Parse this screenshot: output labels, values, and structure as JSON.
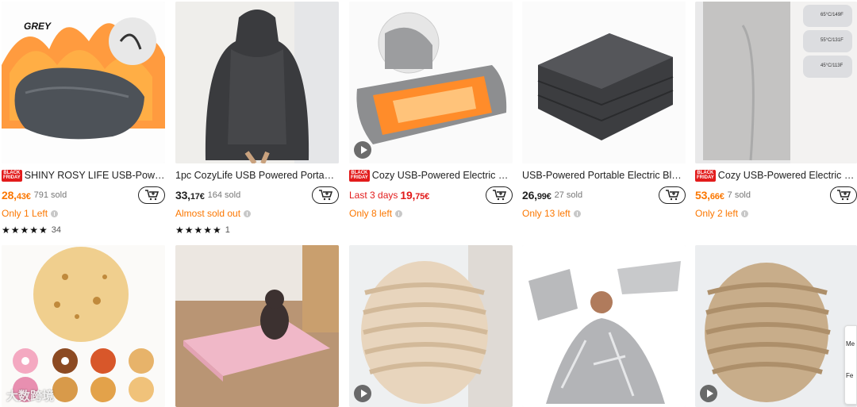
{
  "badge": {
    "line1": "BLACK",
    "line2": "FRIDAY"
  },
  "products": [
    {
      "title": "SHINY ROSY LIFE USB-Powere...",
      "black_friday": true,
      "price_main": "28,",
      "price_cents": "43€",
      "price_color": "orange",
      "sold": "791 sold",
      "stock": "Only 1 Left",
      "stars": "★★★★★",
      "reviews": "34",
      "image_text": "GREY",
      "video": false
    },
    {
      "title": "1pc CozyLife USB Powered Portable F...",
      "black_friday": false,
      "price_main": "33,",
      "price_cents": "17€",
      "price_color": "black",
      "sold": "164 sold",
      "stock": "Almost sold out",
      "stars": "★★★★★",
      "reviews": "1",
      "video": false
    },
    {
      "title": "Cozy USB-Powered Electric Bl...",
      "black_friday": true,
      "promo": "Last 3 days",
      "price_main": "19,",
      "price_cents": "75€",
      "price_color": "red",
      "sold": "",
      "stock": "Only 8 left",
      "video": true
    },
    {
      "title": "USB-Powered Portable Electric Blank...",
      "black_friday": false,
      "price_main": "26,",
      "price_cents": "99€",
      "price_color": "black",
      "sold": "27 sold",
      "stock": "Only 13 left",
      "video": false
    },
    {
      "title": "Cozy USB-Powered Electric Bl...",
      "black_friday": true,
      "price_main": "53,",
      "price_cents": "66€",
      "price_color": "orange",
      "sold": "7 sold",
      "stock": "Only 2 left",
      "video": false,
      "temps": [
        "65°C/149F",
        "55°C/131F",
        "45°C/113F"
      ]
    },
    {
      "image": "tortilla-blanket",
      "video": false,
      "watermark": "大数跨境"
    },
    {
      "image": "pet-mat",
      "video": false
    },
    {
      "image": "faux-fur-blanket",
      "video": true
    },
    {
      "image": "emergency-blanket",
      "video": false
    },
    {
      "image": "faux-fur-blanket-brown",
      "video": true
    }
  ],
  "side_panel": {
    "items": [
      "Me",
      "Fe"
    ]
  },
  "colors": {
    "accent_orange": "#fb7701",
    "promo_red": "#e21b1b"
  },
  "icons": {
    "cart": "add-to-cart-icon",
    "info": "info-icon",
    "play": "play-video-icon"
  }
}
